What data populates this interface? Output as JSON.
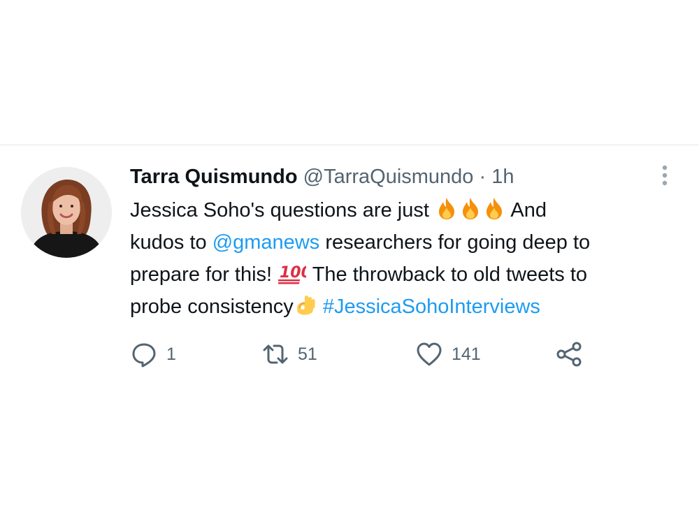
{
  "tweet": {
    "author": {
      "display_name": "Tarra Quismundo",
      "handle": "@TarraQuismundo",
      "separator": "·",
      "time": "1h"
    },
    "text": {
      "line1_start": "Jessica Soho's questions are just",
      "line1_end": "And",
      "line2_start": "kudos to",
      "mention": "@gmanews",
      "line2_end": "researchers for going deep to",
      "line3_start": "prepare for this!",
      "line3_end": "The throwback to old tweets to",
      "line4_start": "probe consistency",
      "hashtag": "#JessicaSohoInterviews"
    },
    "emojis": {
      "fire": "fire-emoji",
      "hundred": "hundred-points-emoji",
      "ok_hand": "ok-hand-emoji"
    },
    "stats": {
      "replies": "1",
      "retweets": "51",
      "likes": "141"
    },
    "icons": {
      "more": "more-options-icon",
      "reply": "reply-icon",
      "retweet": "retweet-icon",
      "like": "heart-icon",
      "share": "share-icon"
    },
    "colors": {
      "link": "#1d9bf0",
      "text": "#0f1419",
      "secondary": "#536471",
      "emoji_fire": "#f4900c",
      "emoji_hundred": "#dd2e44",
      "emoji_ok_hand": "#ffcc4d"
    }
  }
}
